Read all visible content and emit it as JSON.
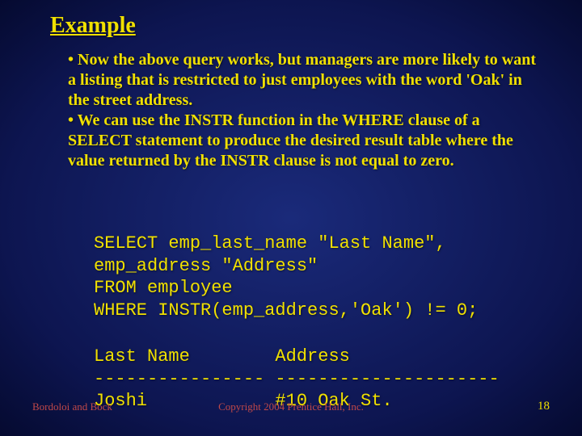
{
  "title": "Example",
  "bullets": [
    "• Now the above query works, but managers are more likely to want a listing that is restricted to just employees with the word 'Oak' in the street address.",
    "• We can use the INSTR function in the WHERE clause of a SELECT statement to produce the desired result table where the value returned by the INSTR clause is not equal to zero."
  ],
  "code": "SELECT emp_last_name \"Last Name\",\nemp_address \"Address\"\nFROM employee\nWHERE INSTR(emp_address,'Oak') != 0;",
  "result": "Last Name        Address\n---------------- ---------------------\nJoshi            #10 Oak St.",
  "footer": {
    "left": "Bordoloi and Bock",
    "center": "Copyright 2004 Prentice Hall, Inc.",
    "page": "18"
  }
}
